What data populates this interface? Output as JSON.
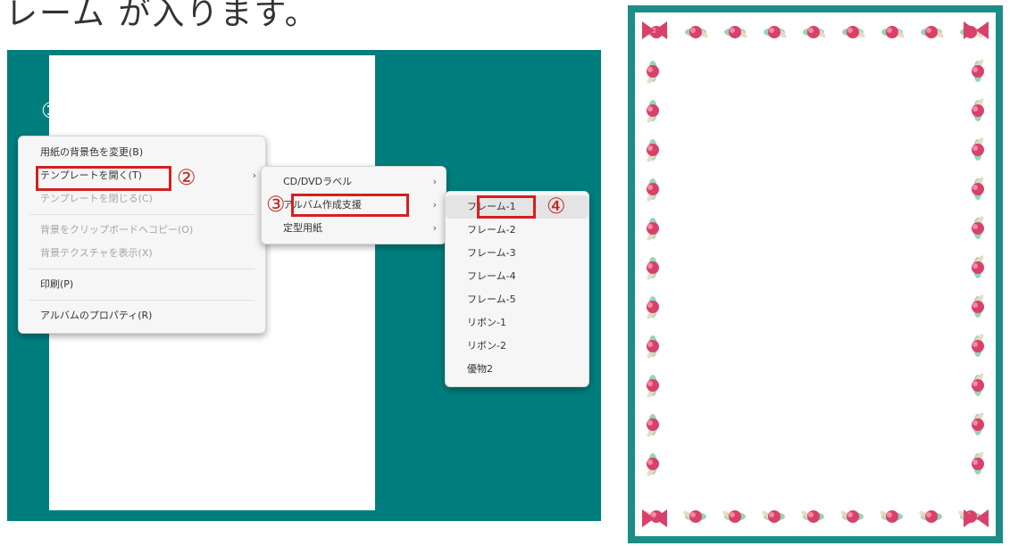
{
  "caption": "レーム が入ります。",
  "steps": {
    "one": "①",
    "two": "②",
    "three": "③",
    "four": "④"
  },
  "context_menu": {
    "items": [
      {
        "label": "用紙の背景色を変更(B)",
        "disabled": false
      },
      {
        "label": "テンプレートを開く(T)",
        "disabled": false,
        "submenu": true
      },
      {
        "label": "テンプレートを閉じる(C)",
        "disabled": true
      },
      {
        "label": "背景をクリップボードへコピー(O)",
        "disabled": true
      },
      {
        "label": "背景テクスチャを表示(X)",
        "disabled": true
      },
      {
        "label": "印刷(P)",
        "disabled": false
      },
      {
        "label": "アルバムのプロパティ(R)",
        "disabled": false
      }
    ]
  },
  "template_submenu": {
    "items": [
      {
        "label": "CD/DVDラベル",
        "submenu": true
      },
      {
        "label": "アルバム作成支援",
        "submenu": true
      },
      {
        "label": "定型用紙",
        "submenu": true
      }
    ]
  },
  "album_submenu": {
    "items": [
      {
        "label": "フレーム-1"
      },
      {
        "label": "フレーム-2"
      },
      {
        "label": "フレーム-3"
      },
      {
        "label": "フレーム-4"
      },
      {
        "label": "フレーム-5"
      },
      {
        "label": "リボン-1"
      },
      {
        "label": "リボン-2"
      },
      {
        "label": "優物2"
      }
    ]
  },
  "colors": {
    "desktop": "#007e7e",
    "highlight": "#d42020",
    "frame_teal": "#1e8c86",
    "flower_pink": "#d9416a",
    "leaf_green": "#7cc9a3"
  }
}
